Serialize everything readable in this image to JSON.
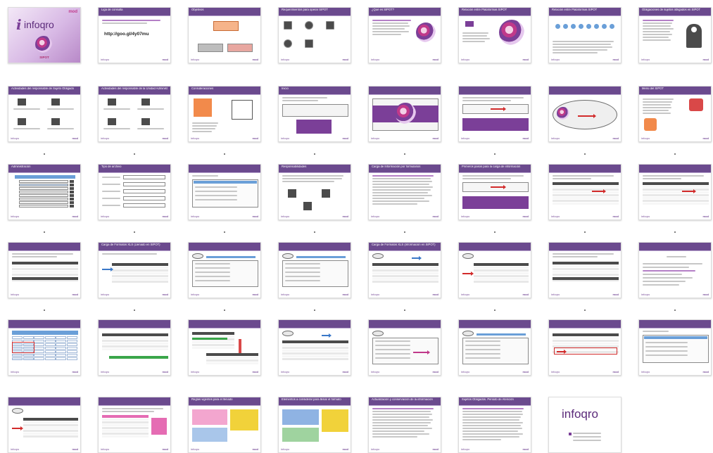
{
  "slide_grid": {
    "brand": {
      "logo_word": "infoqro",
      "corner_tag": "mod",
      "product_tag": "SIPOT",
      "footer_left": "infoqro",
      "footer_right": "mod"
    },
    "rows": [
      [
        {
          "title": "",
          "kind": "title-slide"
        },
        {
          "title": "Liga de consulta",
          "kind": "url",
          "url": "http://goo.gl/4y07mu"
        },
        {
          "title": "Objetivos",
          "kind": "objectives"
        },
        {
          "title": "Requerimientos para operar SIPOT",
          "kind": "icons"
        },
        {
          "title": "¿Qué es SIPOT?",
          "kind": "text-swirl"
        },
        {
          "title": "Relación entre Plataformas SIPOT",
          "kind": "swirl-right"
        },
        {
          "title": "Relación entre Plataformas SIPOT",
          "kind": "timeline"
        },
        {
          "title": "Obligaciones de sujetos obligados en SIPOT",
          "kind": "question"
        }
      ],
      [
        {
          "title": "Actividades del responsable de Sujeto Obligado",
          "kind": "icon-grid"
        },
        {
          "title": "Actividades del responsable de la Unidad Administrativa",
          "kind": "icon-grid"
        },
        {
          "title": "Consideraciones",
          "kind": "person-calendar"
        },
        {
          "title": "Inicio",
          "kind": "screenshot"
        },
        {
          "title": "",
          "kind": "swirl-screen"
        },
        {
          "title": "",
          "kind": "screen-arrow"
        },
        {
          "title": "",
          "kind": "oval-arrow"
        },
        {
          "title": "Menú del SIPOT",
          "kind": "menu-icons"
        }
      ],
      [
        {
          "title": "Administración",
          "kind": "table-form"
        },
        {
          "title": "Tipo de archivo",
          "kind": "form"
        },
        {
          "title": "",
          "kind": "form-plain"
        },
        {
          "title": "Responsabilidades",
          "kind": "steps"
        },
        {
          "title": "Carga de Información por formularios",
          "kind": "text-list"
        },
        {
          "title": "Primeros pasos para la carga de información",
          "kind": "screen-arrow"
        },
        {
          "title": "",
          "kind": "table-arrow"
        },
        {
          "title": "",
          "kind": "table-arrow"
        }
      ],
      [
        {
          "title": "",
          "kind": "table-dark"
        },
        {
          "title": "Carga de Formatos XLS (Llenado en SIPOT)",
          "kind": "table-arrow-blue"
        },
        {
          "title": "",
          "kind": "oval-form"
        },
        {
          "title": "",
          "kind": "oval-form"
        },
        {
          "title": "Carga de Formatos XLS (Información en SIPOT)",
          "kind": "oval-table"
        },
        {
          "title": "",
          "kind": "oval-table-red"
        },
        {
          "title": "",
          "kind": "table-dark"
        },
        {
          "title": "",
          "kind": "text-doc"
        }
      ],
      [
        {
          "title": "",
          "kind": "spreadsheet"
        },
        {
          "title": "",
          "kind": "table-green"
        },
        {
          "title": "",
          "kind": "table-red-green"
        },
        {
          "title": "",
          "kind": "oval-table"
        },
        {
          "title": "",
          "kind": "oval-form-pink"
        },
        {
          "title": "",
          "kind": "oval-form"
        },
        {
          "title": "",
          "kind": "table-red-box"
        },
        {
          "title": "",
          "kind": "form-plain"
        }
      ],
      [
        {
          "title": "",
          "kind": "oval-table-red"
        },
        {
          "title": "",
          "kind": "table-pink"
        },
        {
          "title": "Reglas vigentes para el llenado",
          "kind": "color-notes"
        },
        {
          "title": "Elementos a considerar para llenar el formato",
          "kind": "color-notes-blue"
        },
        {
          "title": "Actualización y conservación de la información",
          "kind": "text-list"
        },
        {
          "title": "Sujetos Obligados. Periodo de Atención",
          "kind": "text-list-bold"
        },
        {
          "title": "",
          "kind": "final-slide"
        }
      ]
    ]
  }
}
